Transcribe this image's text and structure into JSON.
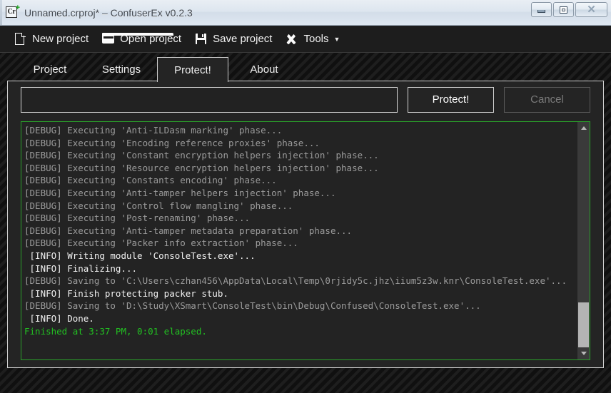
{
  "window": {
    "title": "Unnamed.crproj* – ConfuserEx v0.2.3",
    "icon_label": "Cr",
    "icon_badge": "+",
    "controls": {
      "minimize": "minimize",
      "maximize": "maximize",
      "close": "close"
    }
  },
  "toolbar": {
    "new_project": "New project",
    "open_project": "Open project",
    "save_project": "Save project",
    "tools": "Tools",
    "tools_caret": "▼"
  },
  "tabs": [
    {
      "label": "Project",
      "active": false
    },
    {
      "label": "Settings",
      "active": false
    },
    {
      "label": "Protect!",
      "active": true
    },
    {
      "label": "About",
      "active": false
    }
  ],
  "protect_panel": {
    "progress_value": "",
    "protect_button": "Protect!",
    "cancel_button": "Cancel",
    "log": [
      {
        "text": "[DEBUG] Executing 'Anti-ILDasm marking' phase...",
        "level": "debug"
      },
      {
        "text": "[DEBUG] Executing 'Encoding reference proxies' phase...",
        "level": "debug"
      },
      {
        "text": "[DEBUG] Executing 'Constant encryption helpers injection' phase...",
        "level": "debug"
      },
      {
        "text": "[DEBUG] Executing 'Resource encryption helpers injection' phase...",
        "level": "debug"
      },
      {
        "text": "[DEBUG] Executing 'Constants encoding' phase...",
        "level": "debug"
      },
      {
        "text": "[DEBUG] Executing 'Anti-tamper helpers injection' phase...",
        "level": "debug"
      },
      {
        "text": "[DEBUG] Executing 'Control flow mangling' phase...",
        "level": "debug"
      },
      {
        "text": "[DEBUG] Executing 'Post-renaming' phase...",
        "level": "debug"
      },
      {
        "text": "[DEBUG] Executing 'Anti-tamper metadata preparation' phase...",
        "level": "debug"
      },
      {
        "text": "[DEBUG] Executing 'Packer info extraction' phase...",
        "level": "debug"
      },
      {
        "text": " [INFO] Writing module 'ConsoleTest.exe'...",
        "level": "info"
      },
      {
        "text": " [INFO] Finalizing...",
        "level": "info"
      },
      {
        "text": "[DEBUG] Saving to 'C:\\Users\\czhan456\\AppData\\Local\\Temp\\0rjidy5c.jhz\\iium5z3w.knr\\ConsoleTest.exe'...",
        "level": "debug"
      },
      {
        "text": " [INFO] Finish protecting packer stub.",
        "level": "info"
      },
      {
        "text": "[DEBUG] Saving to 'D:\\Study\\XSmart\\ConsoleTest\\bin\\Debug\\Confused\\ConsoleTest.exe'...",
        "level": "debug"
      },
      {
        "text": " [INFO] Done.",
        "level": "info"
      },
      {
        "text": "Finished at 3:37 PM, 0:01 elapsed.",
        "level": "ok"
      }
    ],
    "scrollbar": {
      "up_arrow": "▲",
      "down_arrow": "▼"
    }
  },
  "colors": {
    "log_border_green": "#2aa02a",
    "finished_green": "#22c022",
    "panel_bg": "#242424",
    "accent_text": "#ffffff"
  }
}
